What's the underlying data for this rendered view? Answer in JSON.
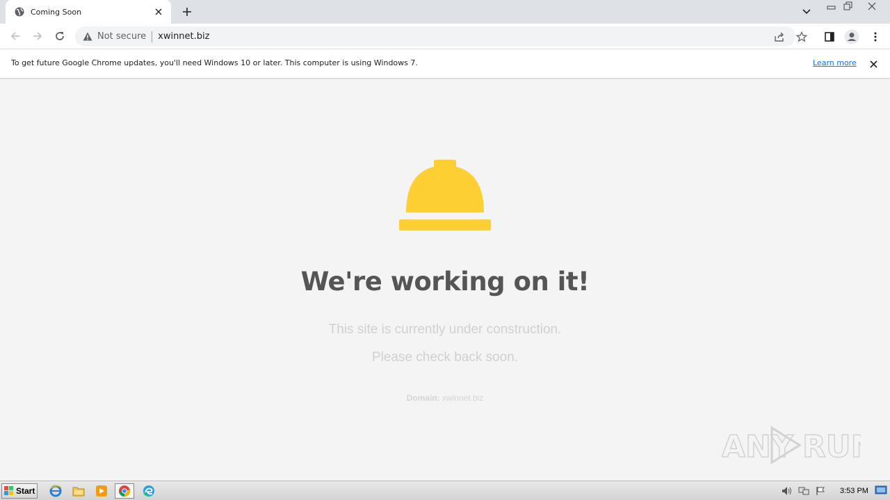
{
  "browser": {
    "tab_title": "Coming Soon",
    "not_secure_label": "Not secure",
    "url": "xwinnet.biz"
  },
  "infobar": {
    "message": "To get future Google Chrome updates, you'll need Windows 10 or later. This computer is using Windows 7.",
    "learn_more": "Learn more"
  },
  "page": {
    "heading": "We're working on it!",
    "line1": "This site is currently under construction.",
    "line2": "Please check back soon.",
    "domain_label": "Domain:",
    "domain_value": "xwinnet.biz",
    "helmet_color": "#fecf33"
  },
  "watermark": {
    "left_text": "ANY",
    "right_text": "RUN"
  },
  "taskbar": {
    "start_label": "Start",
    "clock": "3:53 PM",
    "apps": [
      "ie-icon",
      "explorer-icon",
      "media-player-icon",
      "chrome-icon",
      "edge-icon"
    ]
  }
}
